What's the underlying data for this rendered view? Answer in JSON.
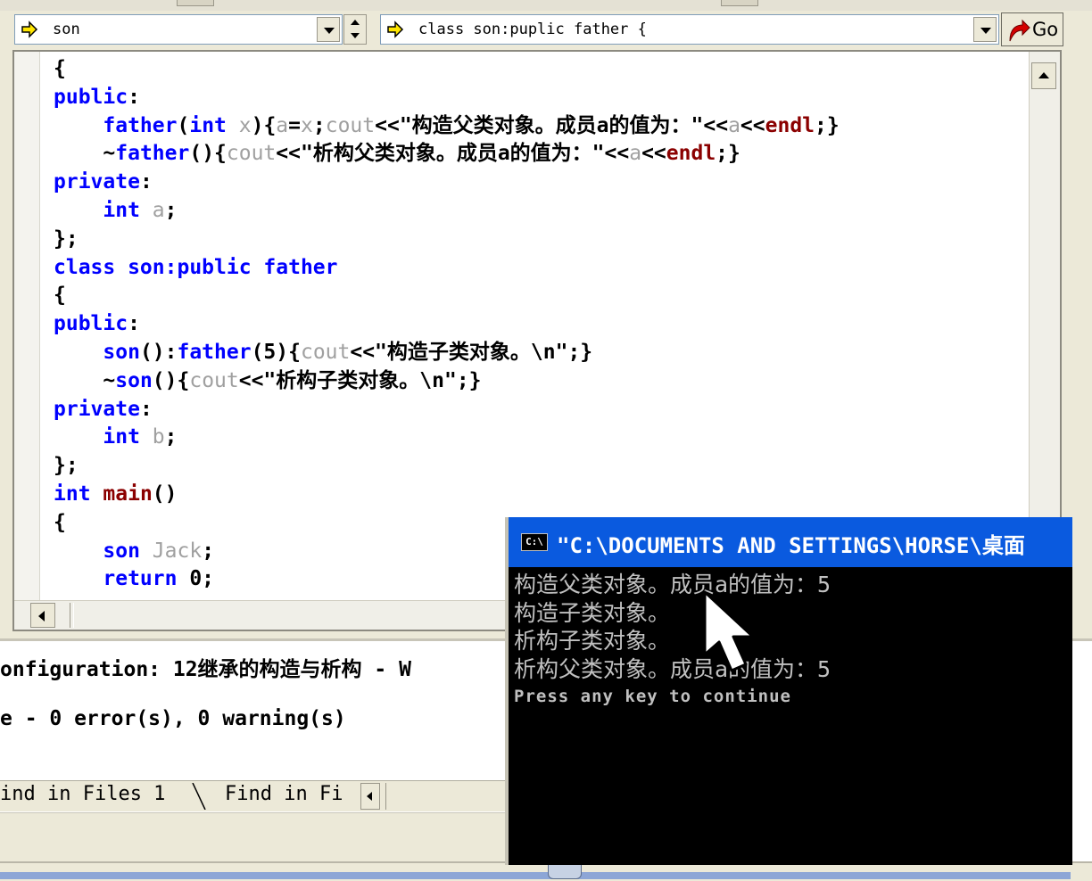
{
  "wizard": {
    "class_combo": "son",
    "member_combo": "class son:puplic father {",
    "go_label": "Go"
  },
  "editor": {
    "lines": [
      [
        {
          "t": "{",
          "c": "plain"
        }
      ],
      [
        {
          "t": "public",
          "c": "kw"
        },
        {
          "t": ":",
          "c": "plain"
        }
      ],
      [
        {
          "t": "    ",
          "c": "plain"
        },
        {
          "t": "father",
          "c": "kw"
        },
        {
          "t": "(",
          "c": "plain"
        },
        {
          "t": "int",
          "c": "kw"
        },
        {
          "t": " x",
          "c": "vr"
        },
        {
          "t": "){",
          "c": "plain"
        },
        {
          "t": "a",
          "c": "vr"
        },
        {
          "t": "=",
          "c": "plain"
        },
        {
          "t": "x",
          "c": "vr"
        },
        {
          "t": ";",
          "c": "plain"
        },
        {
          "t": "cout",
          "c": "vr"
        },
        {
          "t": "<<\"构造父类对象。成员a的值为：\"<<",
          "c": "plain"
        },
        {
          "t": "a",
          "c": "vr"
        },
        {
          "t": "<<",
          "c": "plain"
        },
        {
          "t": "endl",
          "c": "fn"
        },
        {
          "t": ";}",
          "c": "plain"
        }
      ],
      [
        {
          "t": "    ~",
          "c": "plain"
        },
        {
          "t": "father",
          "c": "kw"
        },
        {
          "t": "(){",
          "c": "plain"
        },
        {
          "t": "cout",
          "c": "vr"
        },
        {
          "t": "<<\"析构父类对象。成员a的值为：\"<<",
          "c": "plain"
        },
        {
          "t": "a",
          "c": "vr"
        },
        {
          "t": "<<",
          "c": "plain"
        },
        {
          "t": "endl",
          "c": "fn"
        },
        {
          "t": ";}",
          "c": "plain"
        }
      ],
      [
        {
          "t": "private",
          "c": "kw"
        },
        {
          "t": ":",
          "c": "plain"
        }
      ],
      [
        {
          "t": "    ",
          "c": "plain"
        },
        {
          "t": "int",
          "c": "kw"
        },
        {
          "t": " a",
          "c": "vr"
        },
        {
          "t": ";",
          "c": "plain"
        }
      ],
      [
        {
          "t": "};",
          "c": "plain"
        }
      ],
      [
        {
          "t": "class son:public father",
          "c": "kw"
        }
      ],
      [
        {
          "t": "{",
          "c": "plain"
        }
      ],
      [
        {
          "t": "public",
          "c": "kw"
        },
        {
          "t": ":",
          "c": "plain"
        }
      ],
      [
        {
          "t": "    ",
          "c": "plain"
        },
        {
          "t": "son",
          "c": "kw"
        },
        {
          "t": "():",
          "c": "plain"
        },
        {
          "t": "father",
          "c": "kw"
        },
        {
          "t": "(5){",
          "c": "plain"
        },
        {
          "t": "cout",
          "c": "vr"
        },
        {
          "t": "<<\"构造子类对象。\\n\";}",
          "c": "plain"
        }
      ],
      [
        {
          "t": "    ~",
          "c": "plain"
        },
        {
          "t": "son",
          "c": "kw"
        },
        {
          "t": "(){",
          "c": "plain"
        },
        {
          "t": "cout",
          "c": "vr"
        },
        {
          "t": "<<\"析构子类对象。\\n\";}",
          "c": "plain"
        }
      ],
      [
        {
          "t": "private",
          "c": "kw"
        },
        {
          "t": ":",
          "c": "plain"
        }
      ],
      [
        {
          "t": "    ",
          "c": "plain"
        },
        {
          "t": "int",
          "c": "kw"
        },
        {
          "t": " b",
          "c": "vr"
        },
        {
          "t": ";",
          "c": "plain"
        }
      ],
      [
        {
          "t": "};",
          "c": "plain"
        }
      ],
      [
        {
          "t": "int",
          "c": "kw"
        },
        {
          "t": " ",
          "c": "plain"
        },
        {
          "t": "main",
          "c": "fn"
        },
        {
          "t": "()",
          "c": "plain"
        }
      ],
      [
        {
          "t": "{",
          "c": "plain"
        }
      ],
      [
        {
          "t": "    ",
          "c": "plain"
        },
        {
          "t": "son",
          "c": "kw"
        },
        {
          "t": " Jack",
          "c": "vr"
        },
        {
          "t": ";",
          "c": "plain"
        }
      ],
      [
        {
          "t": "    ",
          "c": "plain"
        },
        {
          "t": "return",
          "c": "kw"
        },
        {
          "t": " 0;",
          "c": "plain"
        }
      ]
    ]
  },
  "output": {
    "config_line": "onfiguration: 12继承的构造与析构 - W",
    "result_line": "e - 0 error(s), 0 warning(s)",
    "tabs": [
      "ind in Files 1",
      "Find in Fi"
    ]
  },
  "console": {
    "title": "\"C:\\DOCUMENTS AND SETTINGS\\HORSE\\桌面",
    "icon_text": "C:\\",
    "lines": [
      "构造父类对象。成员a的值为：5",
      "构造子类对象。",
      "析构子类对象。",
      "析构父类对象。成员a的值为：5",
      "Press any key to continue"
    ]
  },
  "colors": {
    "keyword": "#0000ff",
    "function": "#8b0000",
    "variable": "#a0a0a0",
    "console_title": "#0a5adf",
    "console_bg": "#000000",
    "console_text": "#c0c0c0"
  }
}
